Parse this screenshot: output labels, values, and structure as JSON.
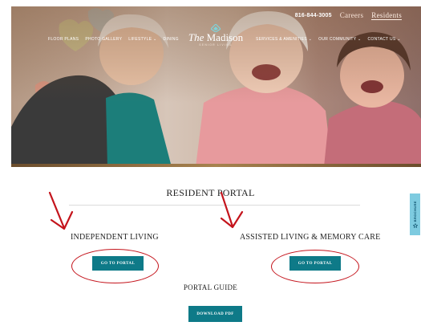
{
  "header": {
    "phone": "816-844-3005",
    "careers": "Careers",
    "residents": "Residents",
    "nav_left": [
      "FLOOR PLANS",
      "PHOTO GALLERY",
      "LIFESTYLE ⌄",
      "DINING"
    ],
    "nav_right": [
      "SERVICES & AMENITIES ⌄",
      "OUR COMMUNITY ⌄",
      "CONTACT US ⌄"
    ],
    "logo": {
      "name_italic": "The",
      "name": "Madison",
      "tagline": "SENIOR LIVING"
    }
  },
  "main": {
    "title": "RESIDENT PORTAL",
    "independent": {
      "heading": "INDEPENDENT LIVING",
      "button": "GO TO PORTAL"
    },
    "assisted": {
      "heading": "ASSISTED LIVING & MEMORY CARE",
      "button": "GO TO PORTAL"
    },
    "guide": {
      "heading": "PORTAL GUIDE",
      "button": "DOWNLOAD PDF"
    }
  },
  "side_tab": {
    "label": "BROCHURE",
    "icon": "bookmark-icon"
  },
  "colors": {
    "teal_button": "#0e7a88",
    "annotation_red": "#c4141c",
    "side_tab": "#7ecbe0"
  }
}
